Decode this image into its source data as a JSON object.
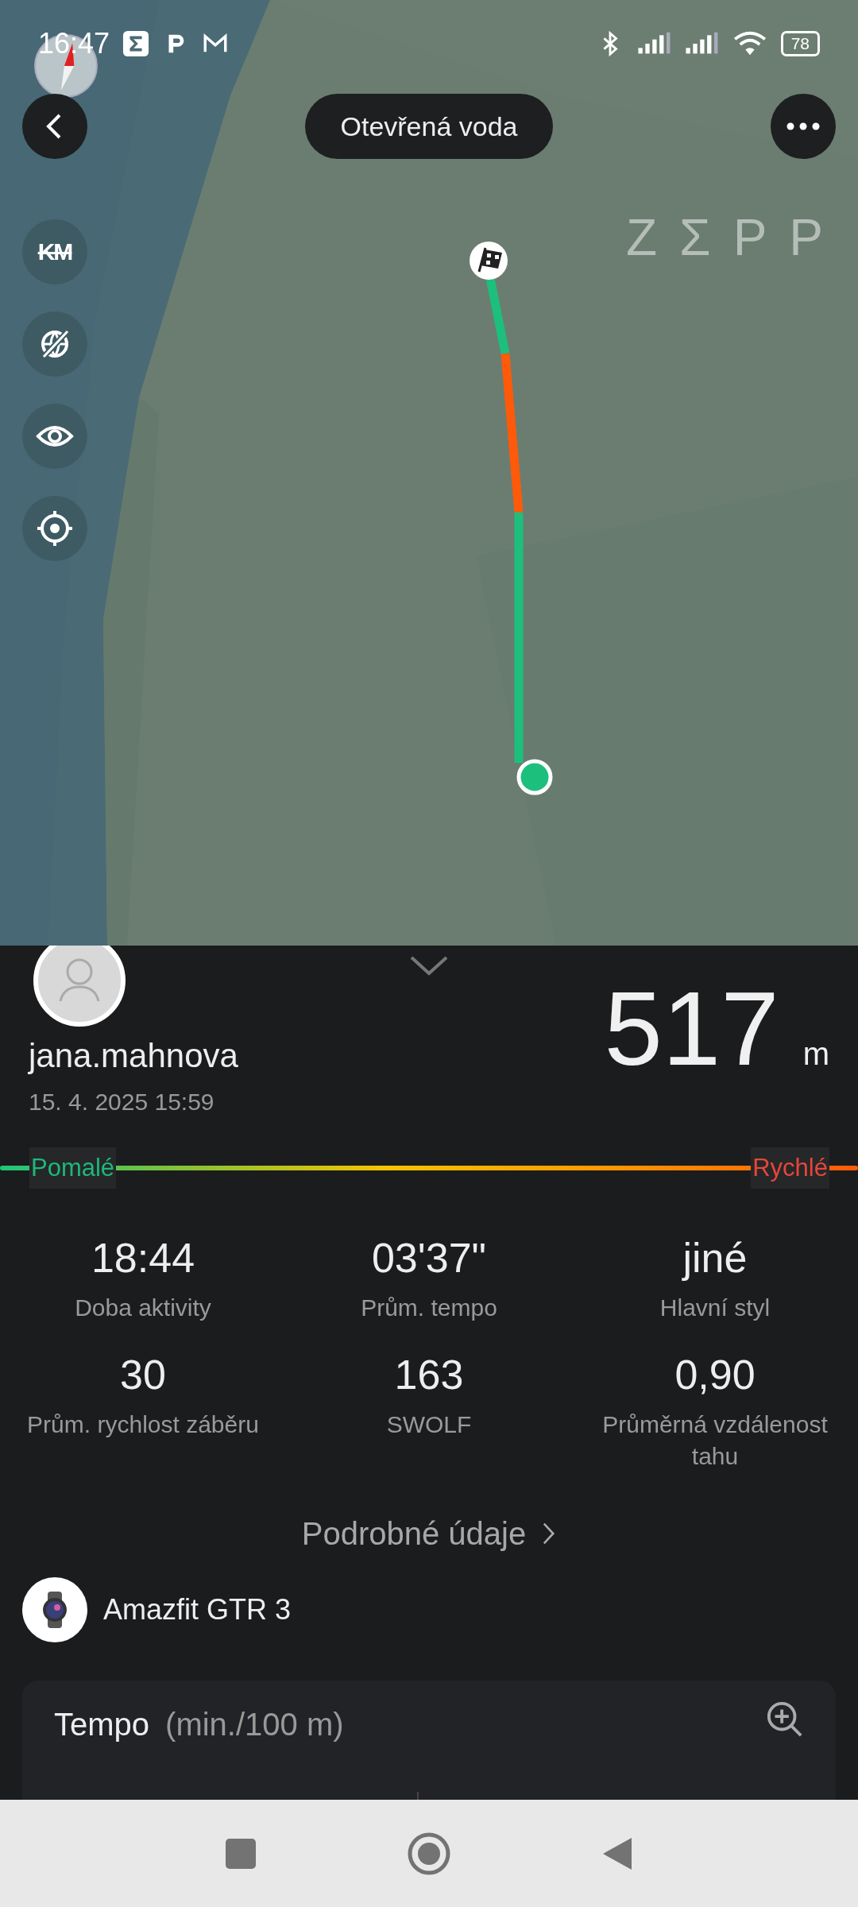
{
  "status_bar": {
    "time": "16:47",
    "battery": "78"
  },
  "header": {
    "title": "Otevřená voda"
  },
  "map": {
    "logo": "ZΣPP",
    "tools": [
      {
        "kind": "units",
        "label": "KM"
      },
      {
        "kind": "globe"
      },
      {
        "kind": "eye"
      },
      {
        "kind": "locate"
      }
    ]
  },
  "summary": {
    "username": "jana.mahnova",
    "date": "15. 4. 2025 15:59",
    "distance": "517",
    "unit": "m",
    "slow_label": "Pomalé",
    "fast_label": "Rychlé"
  },
  "stats": [
    {
      "value": "18:44",
      "label": "Doba aktivity"
    },
    {
      "value": "03'37\"",
      "label": "Prům. tempo"
    },
    {
      "value": "jiné",
      "label": "Hlavní styl"
    },
    {
      "value": "30",
      "label": "Prům. rychlost záběru"
    },
    {
      "value": "163",
      "label": "SWOLF"
    },
    {
      "value": "0,90",
      "label": "Průměrná vzdálenost tahu"
    }
  ],
  "details_link": "Podrobné údaje",
  "device": {
    "name": "Amazfit GTR 3"
  },
  "pace_card": {
    "title": "Tempo",
    "unit": "(min./100 m)"
  }
}
